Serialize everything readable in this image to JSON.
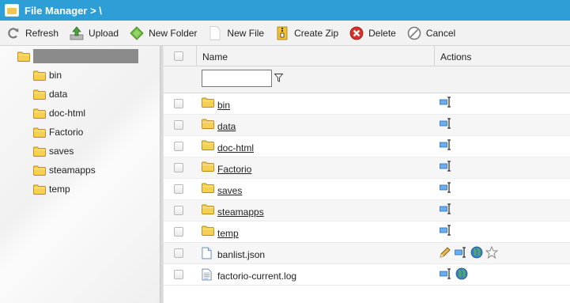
{
  "window": {
    "title": "File Manager > \\"
  },
  "toolbar": {
    "refresh": "Refresh",
    "upload": "Upload",
    "new_folder": "New Folder",
    "new_file": "New File",
    "create_zip": "Create Zip",
    "delete": "Delete",
    "cancel": "Cancel"
  },
  "tree": {
    "items": [
      "bin",
      "data",
      "doc-html",
      "Factorio",
      "saves",
      "steamapps",
      "temp"
    ]
  },
  "grid": {
    "columns": {
      "name": "Name",
      "actions": "Actions"
    },
    "filter_value": "",
    "rows": [
      {
        "name": "bin",
        "type": "folder",
        "actions": [
          "rename-icon"
        ]
      },
      {
        "name": "data",
        "type": "folder",
        "actions": [
          "rename-icon"
        ]
      },
      {
        "name": "doc-html",
        "type": "folder",
        "actions": [
          "rename-icon"
        ]
      },
      {
        "name": "Factorio",
        "type": "folder",
        "actions": [
          "rename-icon"
        ]
      },
      {
        "name": "saves",
        "type": "folder",
        "actions": [
          "rename-icon"
        ]
      },
      {
        "name": "steamapps",
        "type": "folder",
        "actions": [
          "rename-icon"
        ]
      },
      {
        "name": "temp",
        "type": "folder",
        "actions": [
          "rename-icon"
        ]
      },
      {
        "name": "banlist.json",
        "type": "file",
        "actions": [
          "edit-icon",
          "rename-icon",
          "globe-icon",
          "star-icon"
        ]
      },
      {
        "name": "factorio-current.log",
        "type": "log",
        "actions": [
          "rename-icon",
          "globe-icon"
        ]
      }
    ]
  },
  "colors": {
    "titlebar": "#2e9fd6",
    "folder": "#f4c64a",
    "redacted": "#8b8b8b"
  }
}
